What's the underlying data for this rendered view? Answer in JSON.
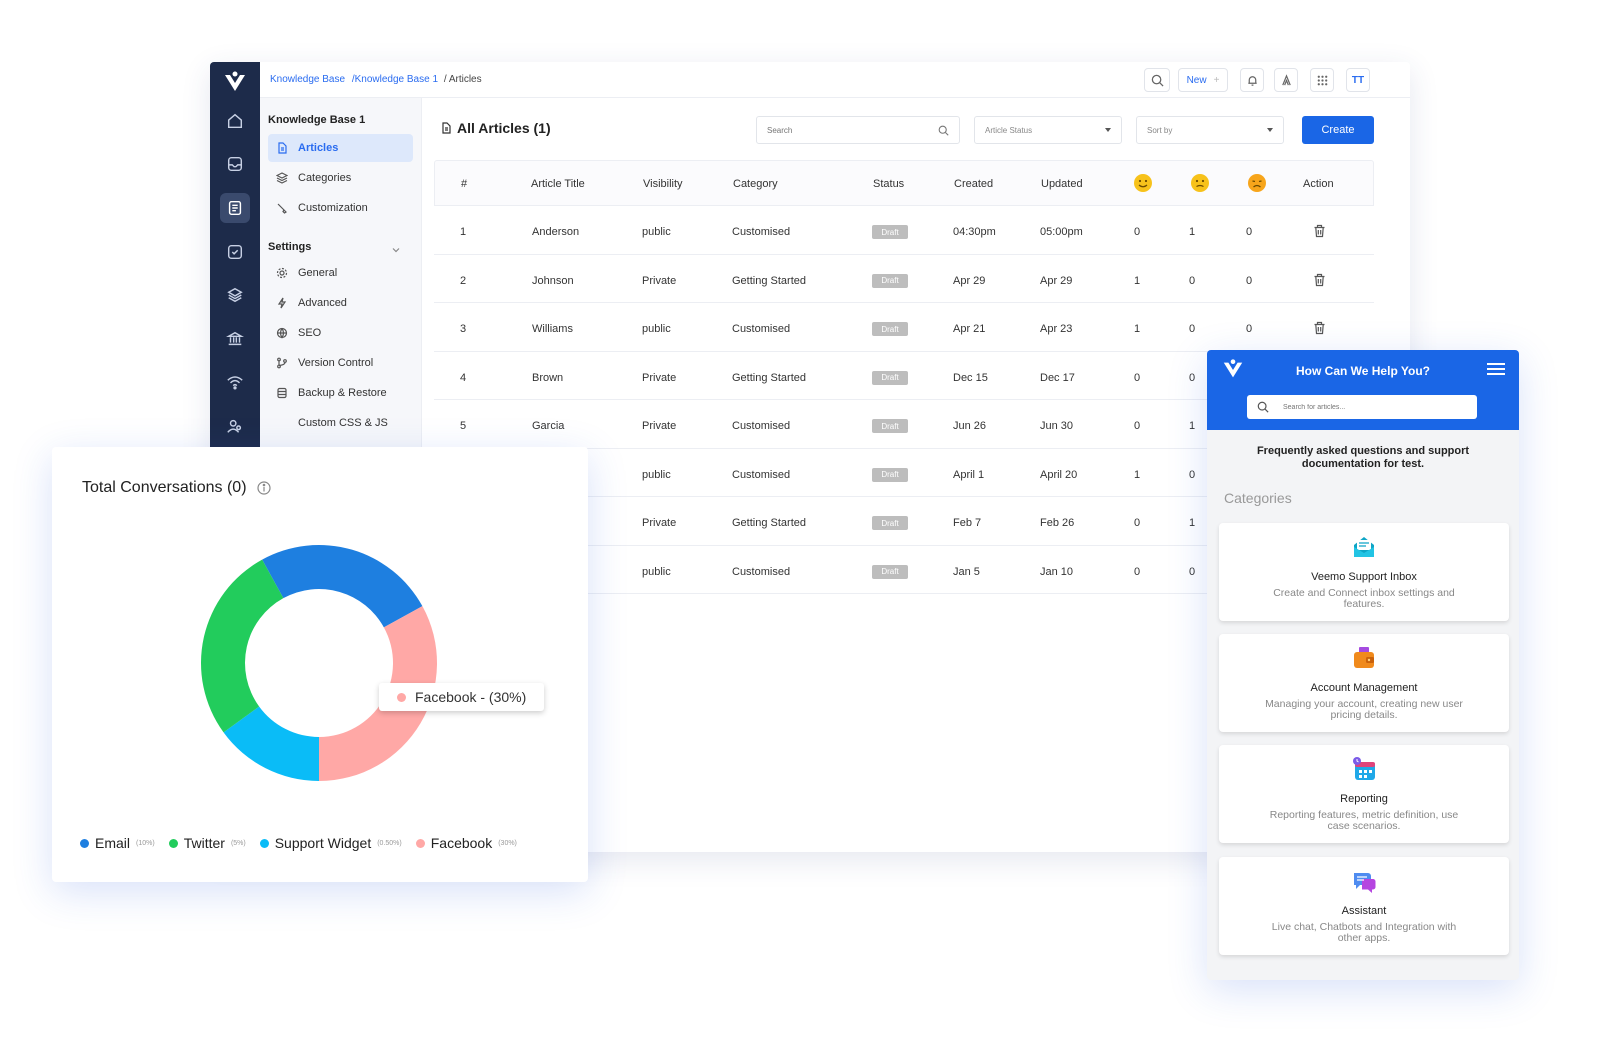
{
  "breadcrumb": {
    "items": [
      "Knowledge Base",
      "Knowledge Base 1"
    ],
    "current": "/ Articles"
  },
  "topbar": {
    "new_label": "New",
    "avatar_initials": "TT"
  },
  "subnav": {
    "title": "Knowledge Base 1",
    "kb_items": [
      {
        "label": "Articles",
        "icon": "document-icon",
        "active": true
      },
      {
        "label": "Categories",
        "icon": "layers-icon"
      },
      {
        "label": "Customization",
        "icon": "brush-icon"
      }
    ],
    "settings_title": "Settings",
    "settings_items": [
      {
        "label": "General",
        "icon": "gear-icon"
      },
      {
        "label": "Advanced",
        "icon": "bolt-icon"
      },
      {
        "label": "SEO",
        "icon": "globe-icon"
      },
      {
        "label": "Version Control",
        "icon": "branch-icon"
      },
      {
        "label": "Backup & Restore",
        "icon": "database-icon"
      },
      {
        "label": "Custom CSS & JS",
        "icon": ""
      }
    ]
  },
  "main": {
    "title": "All Articles (1)",
    "search_placeholder": "Search",
    "status_filter": "Article Status",
    "sort_filter": "Sort by",
    "create_label": "Create",
    "columns": [
      "#",
      "Article Title",
      "Visibility",
      "Category",
      "Status",
      "Created",
      "Updated",
      "Action"
    ],
    "rows": [
      {
        "n": "1",
        "title": "Anderson",
        "visibility": "public",
        "category": "Customised",
        "status": "Draft",
        "created": "04:30pm",
        "updated": "05:00pm",
        "happy": "0",
        "neutral": "1",
        "sad": "0"
      },
      {
        "n": "2",
        "title": "Johnson",
        "visibility": "Private",
        "category": "Getting Started",
        "status": "Draft",
        "created": "Apr 29",
        "updated": "Apr 29",
        "happy": "1",
        "neutral": "0",
        "sad": "0"
      },
      {
        "n": "3",
        "title": "Williams",
        "visibility": "public",
        "category": "Customised",
        "status": "Draft",
        "created": "Apr 21",
        "updated": "Apr 23",
        "happy": "1",
        "neutral": "0",
        "sad": "0"
      },
      {
        "n": "4",
        "title": "Brown",
        "visibility": "Private",
        "category": "Getting Started",
        "status": "Draft",
        "created": "Dec 15",
        "updated": "Dec 17",
        "happy": "0",
        "neutral": "0",
        "sad": ""
      },
      {
        "n": "5",
        "title": "Garcia",
        "visibility": "Private",
        "category": "Customised",
        "status": "Draft",
        "created": "Jun 26",
        "updated": "Jun 30",
        "happy": "0",
        "neutral": "1",
        "sad": ""
      },
      {
        "n": "",
        "title": "",
        "visibility": "public",
        "category": "Customised",
        "status": "Draft",
        "created": "April 1",
        "updated": "April 20",
        "happy": "1",
        "neutral": "0",
        "sad": ""
      },
      {
        "n": "",
        "title": "",
        "visibility": "Private",
        "category": "Getting Started",
        "status": "Draft",
        "created": "Feb 7",
        "updated": "Feb 26",
        "happy": "0",
        "neutral": "1",
        "sad": ""
      },
      {
        "n": "",
        "title": "",
        "visibility": "public",
        "category": "Customised",
        "status": "Draft",
        "created": "Jan 5",
        "updated": "Jan 10",
        "happy": "0",
        "neutral": "0",
        "sad": ""
      }
    ]
  },
  "conversations": {
    "title": "Total Conversations (0)",
    "tooltip": "Facebook - (30%)"
  },
  "chart_data": {
    "type": "pie",
    "title": "Total Conversations (0)",
    "donut": true,
    "series": [
      {
        "name": "Email",
        "label": "(10%)",
        "value": 25,
        "color": "#1e7fe0"
      },
      {
        "name": "Facebook",
        "label": "(30%)",
        "value": 33,
        "color": "#ffa8a6"
      },
      {
        "name": "Support Widget",
        "label": "(0.50%)",
        "value": 15,
        "color": "#0abcf7"
      },
      {
        "name": "Twitter",
        "label": "(5%)",
        "value": 27,
        "color": "#22cc5c"
      }
    ],
    "legend_order": [
      "Email",
      "Twitter",
      "Support Widget",
      "Facebook"
    ],
    "legend_position": "bottom"
  },
  "widget": {
    "title": "How Can We Help You?",
    "search_placeholder": "Search for articles...",
    "description": "Frequently asked questions and support documentation for test.",
    "categories_label": "Categories",
    "cards": [
      {
        "name": "Veemo Support Inbox",
        "desc": "Create and Connect inbox settings and features.",
        "icon": "inbox-icon"
      },
      {
        "name": "Account Management",
        "desc": "Managing your account, creating new user pricing details.",
        "icon": "wallet-icon"
      },
      {
        "name": "Reporting",
        "desc": "Reporting features, metric definition, use case scenarios.",
        "icon": "calendar-icon"
      },
      {
        "name": "Assistant",
        "desc": "Live chat, Chatbots and Integration with other apps.",
        "icon": "chat-icon"
      }
    ]
  },
  "colors": {
    "primary": "#1a66e6",
    "rail": "#1d2b4a",
    "draft": "#bdbdbd"
  }
}
